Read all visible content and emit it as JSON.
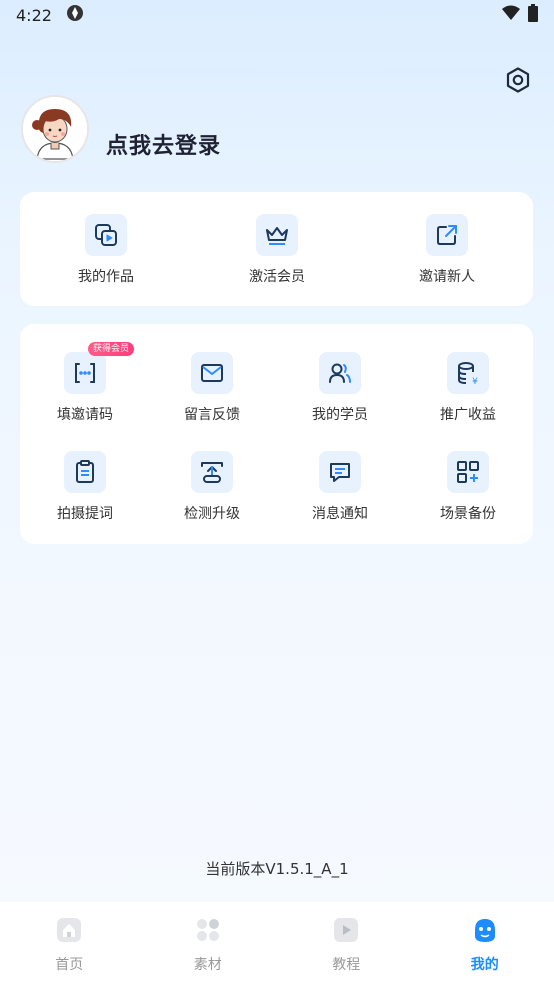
{
  "status_bar": {
    "time": "4:22"
  },
  "header": {
    "login_text": "点我去登录"
  },
  "card_top": {
    "items": [
      {
        "label": "我的作品",
        "icon": "works-icon"
      },
      {
        "label": "激活会员",
        "icon": "crown-icon"
      },
      {
        "label": "邀请新人",
        "icon": "share-icon"
      }
    ]
  },
  "card_grid": {
    "badge": "获得会员",
    "items": [
      {
        "label": "填邀请码",
        "icon": "code-icon"
      },
      {
        "label": "留言反馈",
        "icon": "mail-icon"
      },
      {
        "label": "我的学员",
        "icon": "users-icon"
      },
      {
        "label": "推广收益",
        "icon": "database-icon"
      },
      {
        "label": "拍摄提词",
        "icon": "clipboard-icon"
      },
      {
        "label": "检测升级",
        "icon": "upload-icon"
      },
      {
        "label": "消息通知",
        "icon": "message-icon"
      },
      {
        "label": "场景备份",
        "icon": "grid-plus-icon"
      }
    ]
  },
  "version": "当前版本V1.5.1_A_1",
  "tabbar": {
    "tabs": [
      {
        "label": "首页",
        "active": false
      },
      {
        "label": "素材",
        "active": false
      },
      {
        "label": "教程",
        "active": false
      },
      {
        "label": "我的",
        "active": true
      }
    ]
  },
  "colors": {
    "accent": "#1e8cff",
    "icon_bg": "#e8f2ff",
    "icon_stroke": "#1d3a5c"
  }
}
